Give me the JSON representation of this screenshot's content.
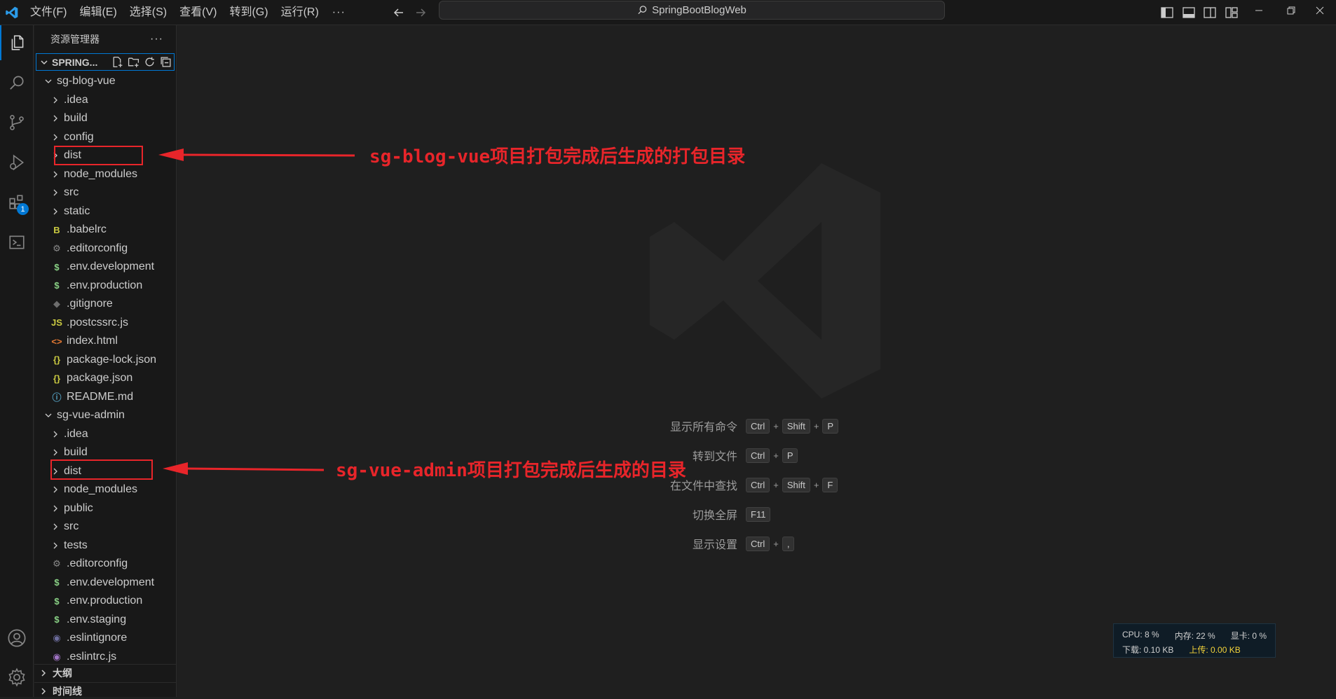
{
  "titlebar": {
    "menu": [
      "文件(F)",
      "编辑(E)",
      "选择(S)",
      "查看(V)",
      "转到(G)",
      "运行(R)"
    ],
    "more": "···",
    "search": "SpringBootBlogWeb"
  },
  "activitybar": {
    "extensions_badge": "1"
  },
  "sidebar": {
    "title": "资源管理器",
    "more": "···",
    "workspace": "SPRING...",
    "tree": [
      {
        "label": "sg-blog-vue",
        "kind": "folder-open",
        "depth": 1
      },
      {
        "label": ".idea",
        "kind": "folder",
        "depth": 2
      },
      {
        "label": "build",
        "kind": "folder",
        "depth": 2
      },
      {
        "label": "config",
        "kind": "folder",
        "depth": 2
      },
      {
        "label": "dist",
        "kind": "folder",
        "depth": 2
      },
      {
        "label": "node_modules",
        "kind": "folder",
        "depth": 2
      },
      {
        "label": "src",
        "kind": "folder",
        "depth": 2
      },
      {
        "label": "static",
        "kind": "folder",
        "depth": 2
      },
      {
        "label": ".babelrc",
        "kind": "file",
        "icon": "babel-icon",
        "glyph": "B",
        "color": "#cbcb41",
        "depth": 2
      },
      {
        "label": ".editorconfig",
        "kind": "file",
        "icon": "gear-icon",
        "glyph": "⚙",
        "color": "#8a8a8a",
        "depth": 2
      },
      {
        "label": ".env.development",
        "kind": "file",
        "icon": "dollar-icon",
        "glyph": "$",
        "color": "#89d185",
        "depth": 2
      },
      {
        "label": ".env.production",
        "kind": "file",
        "icon": "dollar-icon",
        "glyph": "$",
        "color": "#89d185",
        "depth": 2
      },
      {
        "label": ".gitignore",
        "kind": "file",
        "icon": "git-icon",
        "glyph": "◆",
        "color": "#6d6d6d",
        "depth": 2
      },
      {
        "label": ".postcssrc.js",
        "kind": "file",
        "icon": "js-icon",
        "glyph": "JS",
        "color": "#cbcb41",
        "depth": 2
      },
      {
        "label": "index.html",
        "kind": "file",
        "icon": "html-icon",
        "glyph": "<>",
        "color": "#e37933",
        "depth": 2
      },
      {
        "label": "package-lock.json",
        "kind": "file",
        "icon": "json-icon",
        "glyph": "{}",
        "color": "#cbcb41",
        "depth": 2
      },
      {
        "label": "package.json",
        "kind": "file",
        "icon": "json-icon",
        "glyph": "{}",
        "color": "#cbcb41",
        "depth": 2
      },
      {
        "label": "README.md",
        "kind": "file",
        "icon": "info-icon",
        "glyph": "ⓘ",
        "color": "#519aba",
        "depth": 2
      },
      {
        "label": "sg-vue-admin",
        "kind": "folder-open",
        "depth": 1
      },
      {
        "label": ".idea",
        "kind": "folder",
        "depth": 2
      },
      {
        "label": "build",
        "kind": "folder",
        "depth": 2
      },
      {
        "label": "dist",
        "kind": "folder",
        "depth": 2
      },
      {
        "label": "node_modules",
        "kind": "folder",
        "depth": 2
      },
      {
        "label": "public",
        "kind": "folder",
        "depth": 2
      },
      {
        "label": "src",
        "kind": "folder",
        "depth": 2
      },
      {
        "label": "tests",
        "kind": "folder",
        "depth": 2
      },
      {
        "label": ".editorconfig",
        "kind": "file",
        "icon": "gear-icon",
        "glyph": "⚙",
        "color": "#8a8a8a",
        "depth": 2
      },
      {
        "label": ".env.development",
        "kind": "file",
        "icon": "dollar-icon",
        "glyph": "$",
        "color": "#89d185",
        "depth": 2
      },
      {
        "label": ".env.production",
        "kind": "file",
        "icon": "dollar-icon",
        "glyph": "$",
        "color": "#89d185",
        "depth": 2
      },
      {
        "label": ".env.staging",
        "kind": "file",
        "icon": "dollar-icon",
        "glyph": "$",
        "color": "#89d185",
        "depth": 2
      },
      {
        "label": ".eslintignore",
        "kind": "file",
        "icon": "eslint-icon",
        "glyph": "◉",
        "color": "#6d6d9d",
        "depth": 2
      },
      {
        "label": ".eslintrc.js",
        "kind": "file",
        "icon": "eslint-icon",
        "glyph": "◉",
        "color": "#a074c4",
        "depth": 2
      }
    ],
    "sections": [
      "大纲",
      "时间线"
    ]
  },
  "editor": {
    "shortcuts": [
      {
        "label": "显示所有命令",
        "keys": [
          "Ctrl",
          "Shift",
          "P"
        ]
      },
      {
        "label": "转到文件",
        "keys": [
          "Ctrl",
          "P"
        ]
      },
      {
        "label": "在文件中查找",
        "keys": [
          "Ctrl",
          "Shift",
          "F"
        ]
      },
      {
        "label": "切换全屏",
        "keys": [
          "F11"
        ]
      },
      {
        "label": "显示设置",
        "keys": [
          "Ctrl",
          ","
        ]
      }
    ]
  },
  "annotations": {
    "first": "sg-blog-vue项目打包完成后生成的打包目录",
    "second": "sg-vue-admin项目打包完成后生成的目录",
    "color": "#e8252a"
  },
  "sysmon": {
    "cpu": "CPU: 8 %",
    "mem": "内存: 22 %",
    "gpu": "显卡: 0 %",
    "down": "下载: 0.10 KB",
    "up": "上传: 0.00 KB"
  },
  "colors": {
    "accent": "#0078d4",
    "background": "#1f1f1f",
    "sidebar": "#181818"
  }
}
